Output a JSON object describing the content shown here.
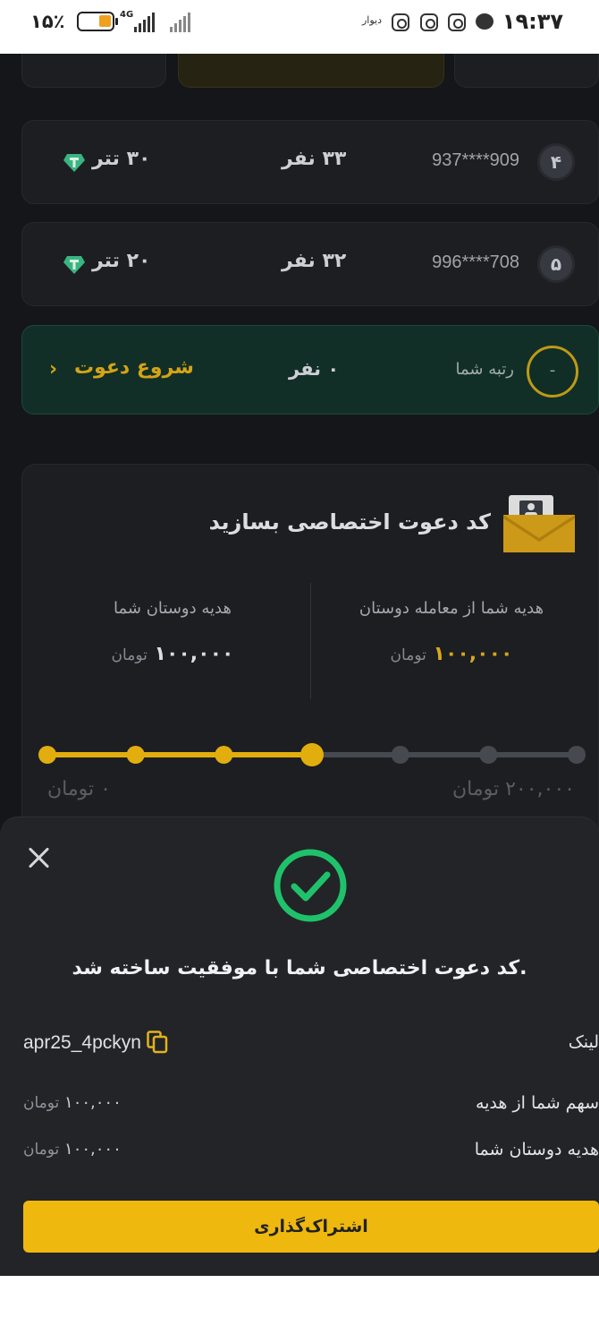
{
  "status_bar": {
    "time": "۱۹:۳۷",
    "battery_percent": "۱۵٪",
    "network": "4G",
    "app_label": "دیوار"
  },
  "leaderboard": [
    {
      "rank": "۴",
      "phone": "937****909",
      "count": "۳۳ نفر",
      "prize": "۳۰ تتر"
    },
    {
      "rank": "۵",
      "phone": "996****708",
      "count": "۳۲ نفر",
      "prize": "۲۰ تتر"
    }
  ],
  "my_rank": {
    "rank_value": "-",
    "label": "رتبه شما",
    "count": "۰ نفر",
    "start_invite": "شروع دعوت",
    "chevron": "›"
  },
  "code_card": {
    "title": "کد دعوت اختصاصی بسازید",
    "your_gift_label": "هدیه شما از معامله دوستان",
    "your_gift_value": "۱۰۰,۰۰۰",
    "friends_gift_label": "هدیه دوستان شما",
    "friends_gift_value": "۱۰۰,۰۰۰",
    "currency": "تومان",
    "progress": {
      "min_label": "۰ تومان",
      "max_label": "۲۰۰,۰۰۰ تومان",
      "steps": 7,
      "current_step": 3
    }
  },
  "sheet": {
    "message": "کد دعوت اختصاصی شما با موفقیت ساخته شد.",
    "link_label": "لینک",
    "link_code": "apr25_4pckyn",
    "share_label": "سهم شما از هدیه",
    "share_value": "۱۰۰,۰۰۰",
    "friends_label": "هدیه دوستان شما",
    "friends_value": "۱۰۰,۰۰۰",
    "currency": "تومان",
    "share_button": "اشتراک‌گذاری"
  },
  "colors": {
    "accent": "#efb80f",
    "success": "#1fc26b",
    "background": "#17181b"
  }
}
